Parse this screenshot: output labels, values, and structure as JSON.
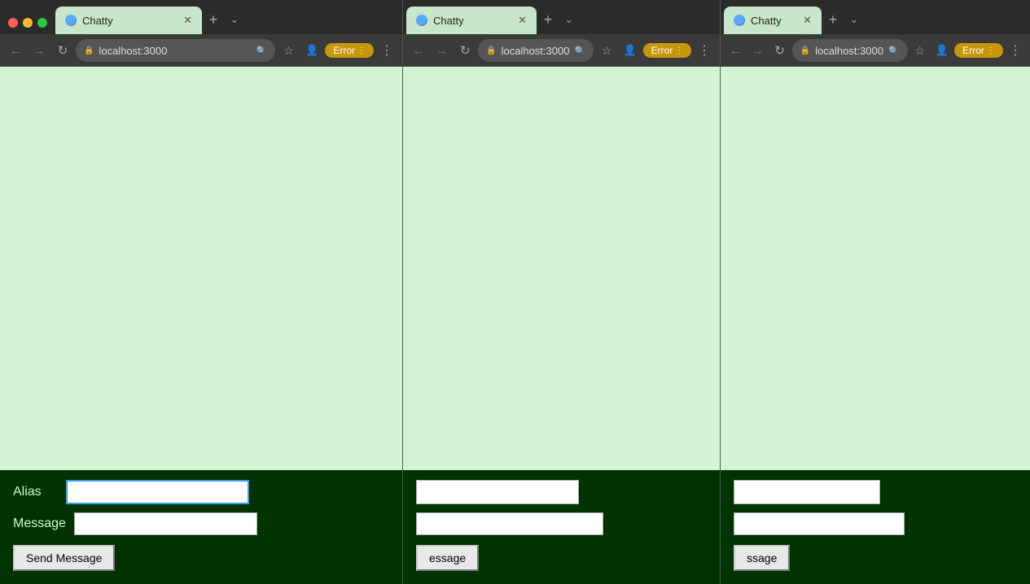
{
  "window1": {
    "tab_label": "Chatty",
    "url": "localhost:3000",
    "error_badge": "Error",
    "alias_label": "Alias",
    "alias_placeholder": "",
    "message_label": "Message",
    "message_placeholder": "",
    "send_button": "Send Message",
    "new_tab_symbol": "+",
    "overflow_symbol": "⌄"
  },
  "window2": {
    "tab_label": "Chatty",
    "url": "localhost:3000",
    "error_badge": "Error",
    "send_button_partial": "essage",
    "new_tab_symbol": "+",
    "overflow_symbol": "⌄"
  },
  "window3": {
    "tab_label": "Chatty",
    "url": "localhost:3000",
    "error_badge": "Error",
    "send_button_partial": "ssage",
    "new_tab_symbol": "+",
    "overflow_symbol": "⌄"
  },
  "nav": {
    "back": "←",
    "forward": "→",
    "reload": "↻",
    "lock": "🔒",
    "search": "🔍",
    "star": "☆",
    "person": "👤",
    "more": "⋮",
    "more_dots": "..."
  },
  "dots": {
    "red": "#ff5f57",
    "yellow": "#febc2e",
    "green": "#28c840"
  }
}
